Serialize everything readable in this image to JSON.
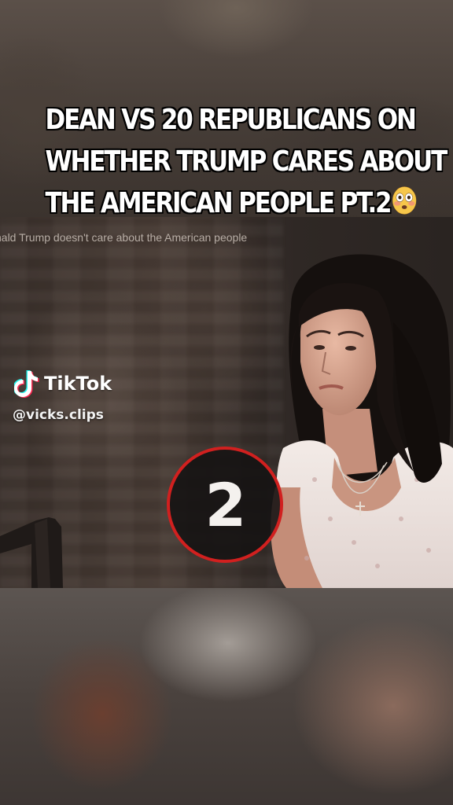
{
  "overlay_title": {
    "lines": [
      "DEAN VS 20 REPUBLICANS ON",
      "WHETHER TRUMP CARES ABOUT",
      "THE AMERICAN PEOPLE PT.2"
    ],
    "emoji": "flushed-face-icon"
  },
  "video": {
    "subtitle_text": "nald Trump doesn't care about the American people",
    "number_badge": "2",
    "badge_ring_color": "#d1201f"
  },
  "watermark": {
    "brand": "TikTok",
    "handle": "@vicks.clips"
  }
}
